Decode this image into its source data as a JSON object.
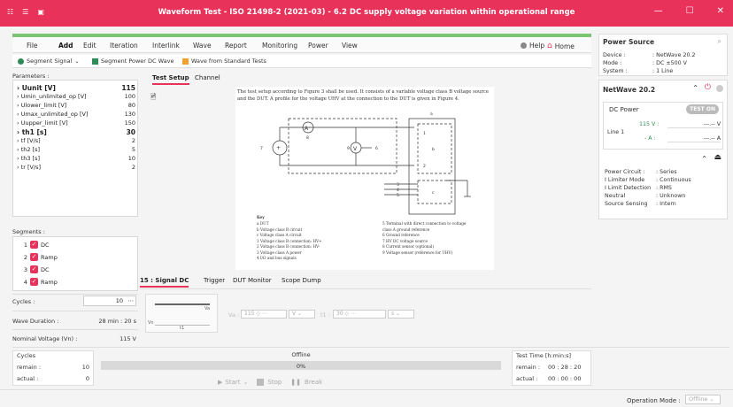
{
  "window": {
    "title": "Waveform Test - ISO 21498-2 (2021-03) - 6.2 DC supply voltage variation within operational range",
    "accent_color": "#e8325a",
    "controls": [
      "—",
      "☐",
      "✕"
    ]
  },
  "menu": {
    "items": [
      "File",
      "Add",
      "Edit",
      "Iteration",
      "Interlink",
      "Wave",
      "Report",
      "Monitoring",
      "Power",
      "View"
    ],
    "active": "Add",
    "help": "Help",
    "home": "Home"
  },
  "toolbar": {
    "segment_signal": "Segment Signal",
    "segment_power": "Segment Power DC Wave",
    "wave_from_standard": "Wave from Standard Tests"
  },
  "parameters": {
    "label": "Parameters :",
    "rows": [
      {
        "name": "Uunit [V]",
        "value": "115",
        "big": true
      },
      {
        "name": "Umin_unlimited_op [V]",
        "value": "100"
      },
      {
        "name": "Ulower_limit [V]",
        "value": "80"
      },
      {
        "name": "Umax_unlimited_op [V]",
        "value": "130"
      },
      {
        "name": "Uupper_limit [V]",
        "value": "150"
      },
      {
        "name": "th1 [s]",
        "value": "30",
        "big": true
      },
      {
        "name": "tf [V/s]",
        "value": "2"
      },
      {
        "name": "th2 [s]",
        "value": "5"
      },
      {
        "name": "th3 [s]",
        "value": "10"
      },
      {
        "name": "tr [V/s]",
        "value": "2"
      }
    ]
  },
  "segments": {
    "label": "Segments :",
    "items": [
      {
        "num": "1",
        "name": "DC"
      },
      {
        "num": "2",
        "name": "Ramp"
      },
      {
        "num": "3",
        "name": "DC"
      },
      {
        "num": "4",
        "name": "Ramp"
      }
    ]
  },
  "summary": {
    "cycles_label": "Cycles :",
    "cycles_value": "10",
    "wave_duration_label": "Wave Duration :",
    "wave_duration_value": "28 min : 20 s",
    "nominal_voltage_label": "Nominal Voltage (Vn) :",
    "nominal_voltage_value": "115 V"
  },
  "doc_tabs": {
    "test_setup": "Test Setup",
    "channel": "Channel"
  },
  "doc": {
    "intro": "The test setup according to Figure 3 shall be used. It consists of a variable voltage class B voltage source and the DUT. A profile for the voltage UHV at the connection to the DUT is given in Figure 4.",
    "key_title": "Key",
    "key_left": [
      "a   DUT",
      "b   Voltage class B circuit",
      "c   Voltage class A circuit",
      "1   Voltage class B connection: HV+",
      "2   Voltage class B connection: HV-",
      "3   Voltage class A power",
      "4   I/O and bus signals"
    ],
    "key_right": [
      "5   Terminal with direct connection to voltage",
      "     class A ground reference",
      "6   Ground reference",
      "7   HV DC voltage source",
      "8   Current sensor (optional)",
      "9   Voltage sensor (reference for UHV)"
    ],
    "labels": {
      "a": "a",
      "b": "b",
      "c": "c",
      "n1": "1",
      "n2": "2",
      "n3": "3",
      "n4": "4",
      "n5": "5",
      "n6": "6",
      "n7": "7",
      "n8": "8",
      "n9": "9",
      "amp": "A",
      "volt": "V"
    }
  },
  "signal_tabs": {
    "signal_dc": "15 : Signal DC",
    "trigger": "Trigger",
    "dut_monitor": "DUT Monitor",
    "scope_dump": "Scope Dump"
  },
  "signal_dc": {
    "va_label": "Va :",
    "va_value": "115",
    "va_unit": "V",
    "t1_label": "t1 :",
    "t1_value": "30",
    "t1_unit": "s",
    "vn": "Vn",
    "va": "Va",
    "t1": "t1"
  },
  "run": {
    "cycles_group": "Cycles",
    "remain_label": "remain :",
    "remain_value": "10",
    "actual_label": "actual :",
    "actual_value": "0",
    "status": "Offline",
    "progress": "0%",
    "progress_fraction": 0,
    "start": "Start",
    "stop": "Stop",
    "break": "Break",
    "test_time_label": "Test Time [h:min:s]",
    "tt_remain_label": "remain :",
    "tt_remain_value": "00 : 28 : 20",
    "tt_actual_label": "actual :",
    "tt_actual_value": "00 : 00 : 00"
  },
  "power_source": {
    "title": "Power Source",
    "device_label": "Device :",
    "device_value": ": NetWave 20.2",
    "mode_label": "Mode :",
    "mode_value": ": DC ±500 V",
    "system_label": "System :",
    "system_value": ": 1 Line",
    "unit_title": "NetWave 20.2",
    "dc_power": "DC Power",
    "test_on": "TEST ON",
    "line1": "Line 1",
    "volt_set": "115 V :",
    "volt_meas": "---.-- V",
    "amp_set": "- A :",
    "amp_meas": "---.-- A",
    "details": [
      {
        "k": "Power Circuit :",
        "v": ": Series"
      },
      {
        "k": "I Limiter Mode",
        "v": ": Continuous"
      },
      {
        "k": "I Limit Detection",
        "v": ": RMS"
      },
      {
        "k": "Neutral",
        "v": ": Unknown"
      },
      {
        "k": "Source Sensing",
        "v": ": Intern"
      }
    ]
  },
  "status_bar": {
    "operation_mode_label": "Operation Mode :",
    "operation_mode_value": "Offline"
  }
}
